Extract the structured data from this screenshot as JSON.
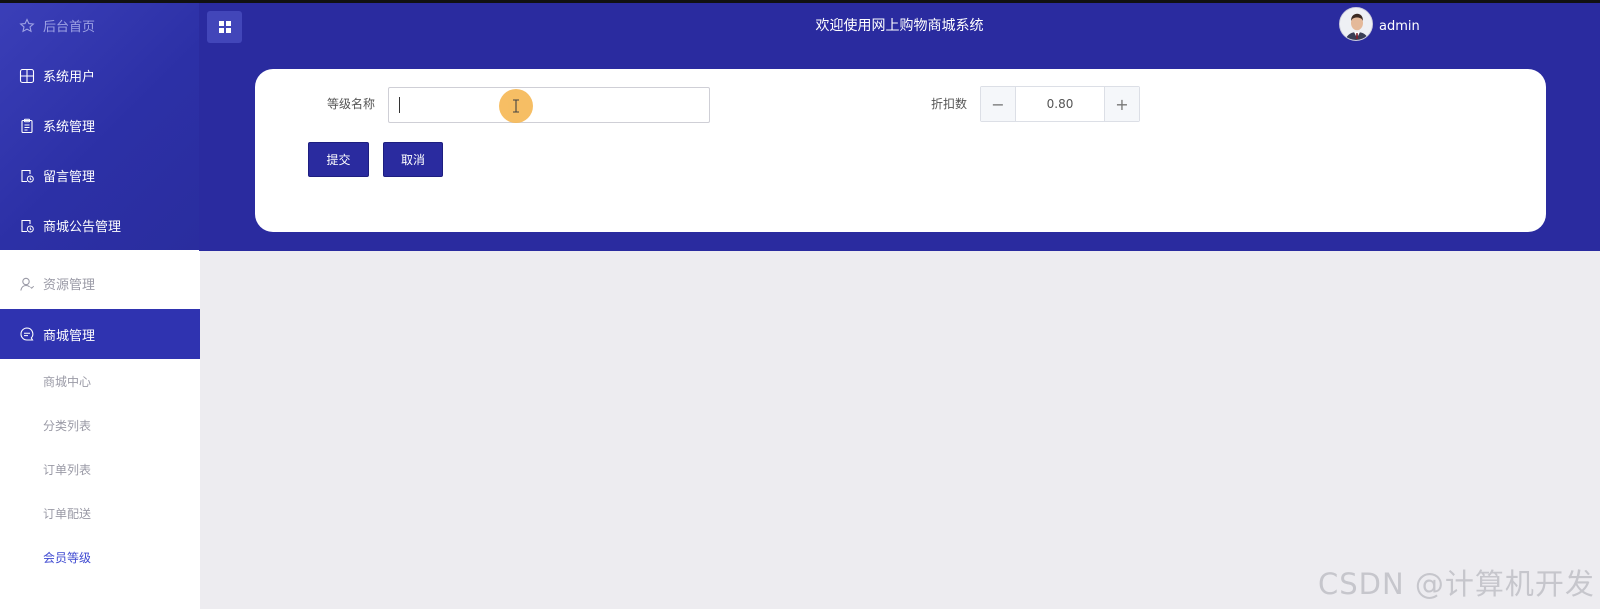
{
  "header": {
    "title": "欢迎使用网上购物商城系统",
    "username": "admin"
  },
  "sidebar": {
    "items": [
      {
        "label": "后台首页",
        "icon": "star-icon"
      },
      {
        "label": "系统用户",
        "icon": "grid-icon"
      },
      {
        "label": "系统管理",
        "icon": "clipboard-icon"
      },
      {
        "label": "留言管理",
        "icon": "document-clock-icon"
      },
      {
        "label": "商城公告管理",
        "icon": "document-clock-icon"
      },
      {
        "label": "资源管理",
        "icon": "user-icon"
      },
      {
        "label": "商城管理",
        "icon": "chat-icon"
      }
    ],
    "subitems": [
      {
        "label": "商城中心"
      },
      {
        "label": "分类列表"
      },
      {
        "label": "订单列表"
      },
      {
        "label": "订单配送"
      },
      {
        "label": "会员等级"
      }
    ]
  },
  "form": {
    "level_name_label": "等级名称",
    "level_name_value": "",
    "discount_label": "折扣数",
    "discount_value": "0.80",
    "minus_label": "−",
    "plus_label": "+",
    "submit_label": "提交",
    "cancel_label": "取消"
  },
  "watermark": "CSDN @计算机开发",
  "colors": {
    "primary": "#2a2b9f",
    "sidebar_active": "#2f33b0",
    "current_link": "#3f4ad1",
    "cursor_highlight": "#f6b957"
  }
}
